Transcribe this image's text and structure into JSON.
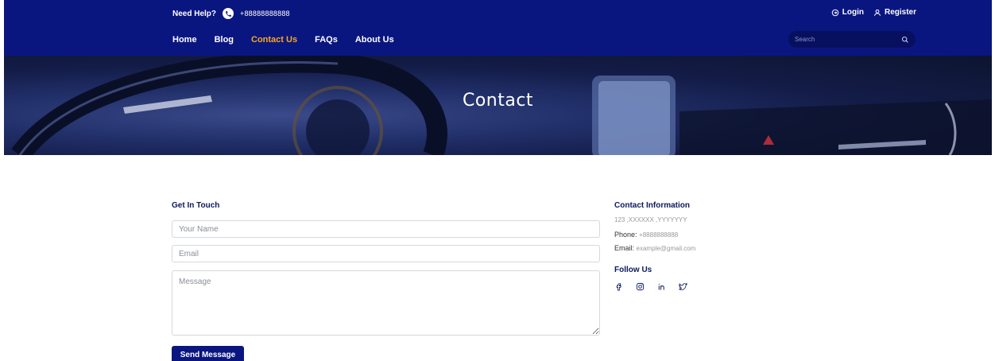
{
  "topbar": {
    "help_label": "Need Help?",
    "phone": "+88888888888",
    "login_label": "Login",
    "register_label": "Register"
  },
  "nav": {
    "items": [
      {
        "label": "Home",
        "active": false
      },
      {
        "label": "Blog",
        "active": false
      },
      {
        "label": "Contact Us",
        "active": true
      },
      {
        "label": "FAQs",
        "active": false
      },
      {
        "label": "About Us",
        "active": false
      }
    ],
    "search_placeholder": "Search"
  },
  "hero": {
    "title": "Contact"
  },
  "form": {
    "title": "Get In Touch",
    "name_placeholder": "Your Name",
    "email_placeholder": "Email",
    "message_placeholder": "Message",
    "submit_label": "Send Message"
  },
  "contact_info": {
    "title": "Contact Information",
    "address": "123 ,XXXXXX ,YYYYYYY",
    "phone_label": "Phone:",
    "phone_value": "+8888888888",
    "email_label": "Email:",
    "email_value": "example@gmail.com"
  },
  "follow": {
    "title": "Follow Us",
    "icons": [
      "facebook-icon",
      "instagram-icon",
      "linkedin-icon",
      "twitter-icon"
    ]
  },
  "colors": {
    "header_bg": "#0a1680",
    "nav_active": "#f5a623",
    "heading": "#0b1a5c",
    "button_bg": "#0a1680"
  }
}
